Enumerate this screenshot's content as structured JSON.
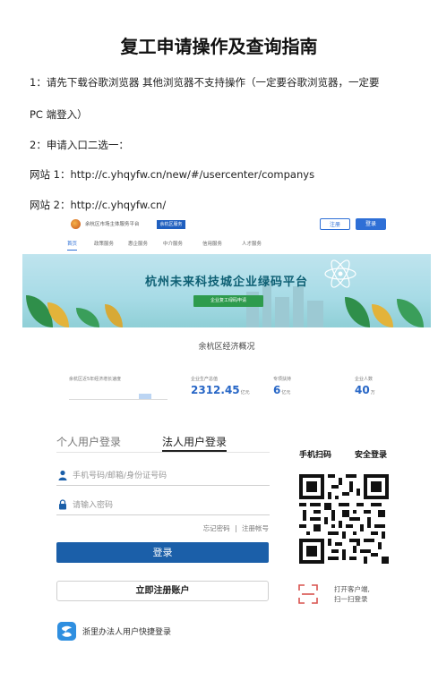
{
  "doc": {
    "title": "复工申请操作及查询指南",
    "line1": "1：请先下载谷歌浏览器  其他浏览器不支持操作（一定要谷歌浏览器，一定要",
    "line1b": "PC 端登入）",
    "line2": "2：申请入口二选一：",
    "site1": "网站 1：http://c.yhqyfw.cn/new/#/usercenter/companys",
    "site2": "网站 2：http://c.yhqyfw.cn/"
  },
  "screenshot": {
    "site_name": "余杭区市场主体服务平台",
    "badge": "余杭区服务",
    "login": "注册",
    "register": "登录",
    "nav": [
      "首页",
      "政策服务",
      "惠企服务",
      "中介服务",
      "信用服务",
      "人才服务"
    ],
    "banner_title": "杭州未来科技城企业绿码平台",
    "banner_button": "企业复工绿码申请",
    "section_title": "余杭区经济概况",
    "chart_caption": "余杭区近5年经济增长速度",
    "stats": [
      {
        "label": "企业生产总值",
        "value": "2312.45",
        "unit": "亿元"
      },
      {
        "label": "专项扶持",
        "value": "6",
        "unit": "亿元"
      },
      {
        "label": "企业人数",
        "value": "40",
        "unit": "万"
      }
    ]
  },
  "login_panel": {
    "tab_personal": "个人用户登录",
    "tab_legal": "法人用户登录",
    "account_placeholder": "手机号码/邮箱/身份证号码",
    "password_placeholder": "请输入密码",
    "forgot": "忘记密码",
    "separator": "|",
    "register_link": "注册帐号",
    "login_button": "登录",
    "register_button": "立即注册账户",
    "zlb_text": "浙里办法人用户快捷登录",
    "qr_tab_scan": "手机扫码",
    "qr_tab_secure": "安全登录",
    "scan_hint_1": "打开客户端,",
    "scan_hint_2": "扫一扫登录"
  },
  "colors": {
    "primary": "#1b5fa9",
    "site_blue": "#2e6fd6",
    "banner_green": "#2e9b4d"
  }
}
